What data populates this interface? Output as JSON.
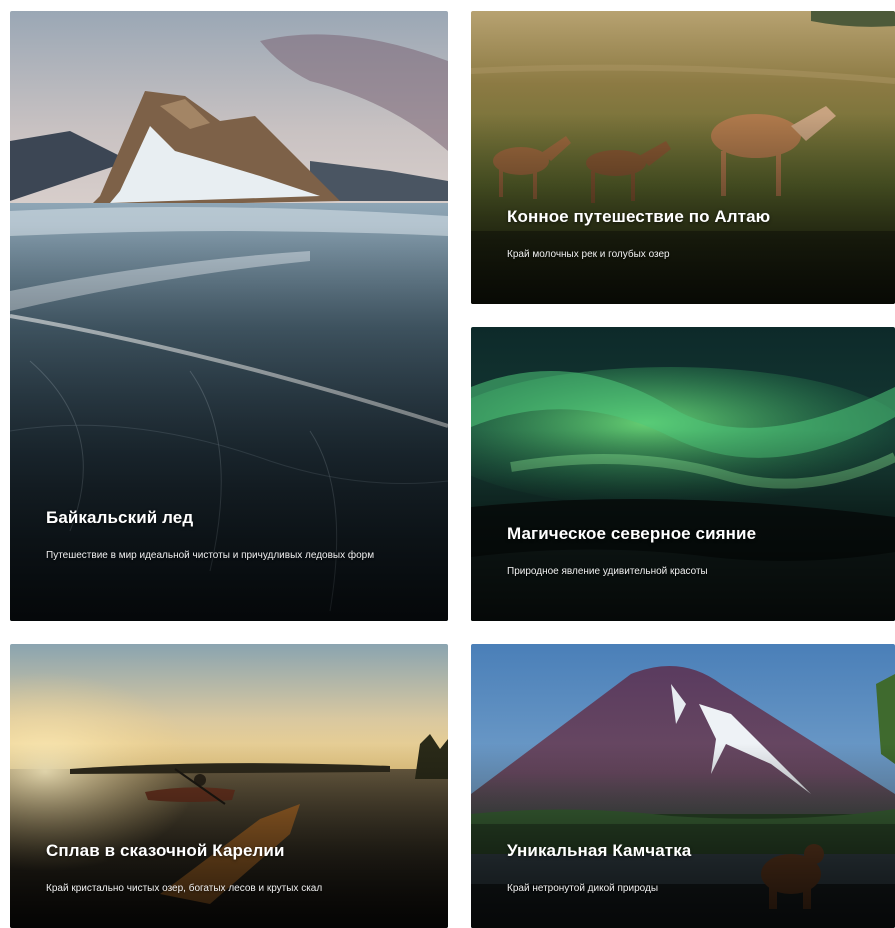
{
  "cards": [
    {
      "id": "baikal",
      "title": "Байкальский лед",
      "subtitle": "Путешествие в мир идеальной чистоты и причудливых ледовых форм"
    },
    {
      "id": "altai",
      "title": "Конное путешествие по Алтаю",
      "subtitle": "Край молочных рек и голубых озер"
    },
    {
      "id": "aurora",
      "title": "Магическое северное сияние",
      "subtitle": "Природное явление удивительной красоты"
    },
    {
      "id": "karelia",
      "title": "Сплав в сказочной Карелии",
      "subtitle": "Край кристально чистых озер, богатых лесов и крутых скал"
    },
    {
      "id": "kamchatka",
      "title": "Уникальная Камчатка",
      "subtitle": "Край нетронутой дикой природы"
    }
  ]
}
